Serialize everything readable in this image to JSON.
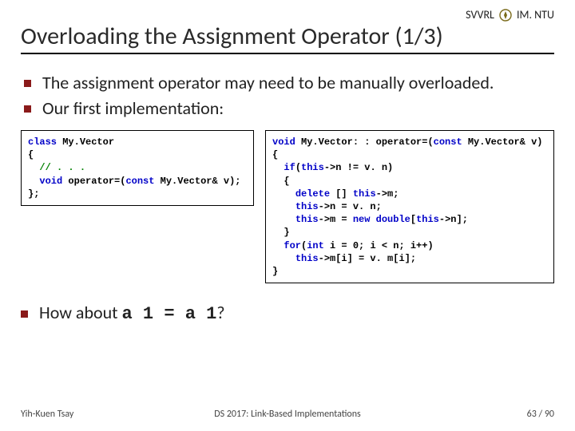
{
  "header": {
    "org_left": "SVVRL",
    "org_right": "IM. NTU"
  },
  "title": "Overloading the Assignment Operator (1/3)",
  "bullets": [
    "The assignment operator may need to be manually overloaded.",
    "Our first implementation:"
  ],
  "code_left": {
    "l1a": "class",
    "l1b": " My.Vector",
    "l2": "{",
    "l3a": "  ",
    "l3b": "// . . .",
    "l4a": "  ",
    "l4b": "void",
    "l4c": " operator=(",
    "l4d": "const",
    "l4e": " My.Vector& v);",
    "l5": "};"
  },
  "code_right": {
    "l1a": "void",
    "l1b": " My.Vector: : operator=(",
    "l1c": "const",
    "l1d": " My.Vector& v)",
    "l2": "{",
    "l3a": "  ",
    "l3b": "if",
    "l3c": "(",
    "l3d": "this",
    "l3e": "->n != v. n)",
    "l4": "  {",
    "l5a": "    ",
    "l5b": "delete",
    "l5c": " [] ",
    "l5d": "this",
    "l5e": "->m;",
    "l6a": "    ",
    "l6b": "this",
    "l6c": "->n = v. n;",
    "l7a": "    ",
    "l7b": "this",
    "l7c": "->m = ",
    "l7d": "new",
    "l7e": " ",
    "l7f": "double",
    "l7g": "[",
    "l7h": "this",
    "l7i": "->n];",
    "l8": "  }",
    "l9a": "  ",
    "l9b": "for",
    "l9c": "(",
    "l9d": "int",
    "l9e": " i = 0; i < n; i++)",
    "l10a": "    ",
    "l10b": "this",
    "l10c": "->m[i] = v. m[i];",
    "l11": "}"
  },
  "howabout": {
    "prefix": "How about ",
    "code": "a 1 = a 1",
    "suffix": "?"
  },
  "footer": {
    "left": "Yih-Kuen Tsay",
    "center": "DS 2017: Link-Based Implementations",
    "right": "63 / 90"
  }
}
